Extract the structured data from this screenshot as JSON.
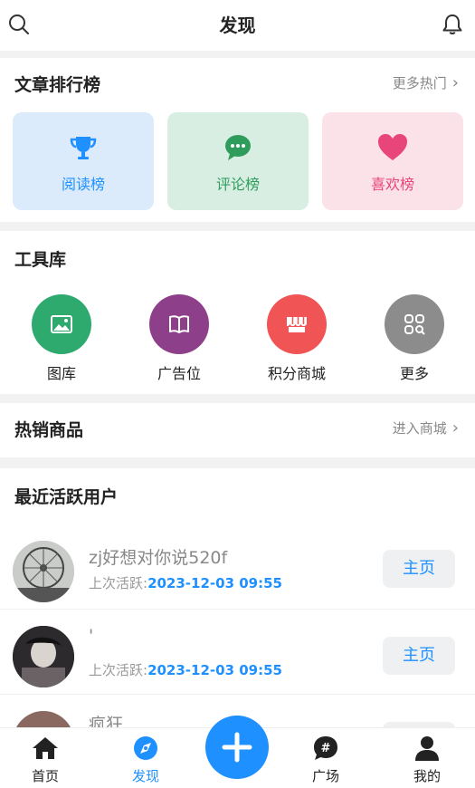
{
  "header": {
    "title": "发现"
  },
  "ranking": {
    "title": "文章排行榜",
    "more": "更多热门",
    "cards": [
      {
        "label": "阅读榜",
        "color": "#1E90FF",
        "bg": "#dcebfb",
        "icon": "trophy-icon"
      },
      {
        "label": "评论榜",
        "color": "#2e9d5c",
        "bg": "#d8eee3",
        "icon": "comment-icon"
      },
      {
        "label": "喜欢榜",
        "color": "#e8457a",
        "bg": "#fbe1e8",
        "icon": "heart-icon"
      }
    ]
  },
  "tools": {
    "title": "工具库",
    "items": [
      {
        "label": "图库",
        "color": "#2eaa6f",
        "icon": "image-icon"
      },
      {
        "label": "广告位",
        "color": "#8e3f8a",
        "icon": "book-icon"
      },
      {
        "label": "积分商城",
        "color": "#f05454",
        "icon": "shop-icon"
      },
      {
        "label": "更多",
        "color": "#8c8c8c",
        "icon": "grid-search-icon"
      }
    ]
  },
  "hot": {
    "title": "热销商品",
    "more": "进入商城"
  },
  "users": {
    "title": "最近活跃用户",
    "active_label": "上次活跃:",
    "button_label": "主页",
    "list": [
      {
        "name": "zj好想对你说520f",
        "time": "2023-12-03 09:55"
      },
      {
        "name": "'",
        "time": "2023-12-03 09:55"
      },
      {
        "name": "疯狂",
        "time": ""
      }
    ]
  },
  "tabbar": {
    "items": [
      {
        "label": "首页",
        "icon": "home-icon"
      },
      {
        "label": "发现",
        "icon": "compass-icon",
        "active": true
      },
      {
        "label": "广场",
        "icon": "hashtag-icon"
      },
      {
        "label": "我的",
        "icon": "user-icon"
      }
    ],
    "accent": "#1E90FF"
  }
}
